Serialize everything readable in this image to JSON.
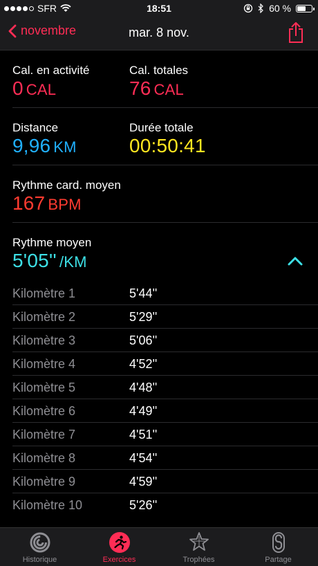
{
  "status_bar": {
    "carrier": "SFR",
    "time": "18:51",
    "battery": "60 %",
    "battery_level": 0.6
  },
  "nav": {
    "back_label": "novembre",
    "title": "mar. 8 nov."
  },
  "stats": {
    "active_cal": {
      "label": "Cal. en activité",
      "value": "0",
      "unit": "CAL",
      "color": "#ff2d55"
    },
    "total_cal": {
      "label": "Cal. totales",
      "value": "76",
      "unit": "CAL",
      "color": "#ff2d55"
    },
    "distance": {
      "label": "Distance",
      "value": "9,96",
      "unit": "KM",
      "color": "#20b0ff"
    },
    "duration": {
      "label": "Durée totale",
      "value": "00:50:41",
      "color": "#ffe620"
    },
    "heart_rate": {
      "label": "Rythme card. moyen",
      "value": "167",
      "unit": "BPM",
      "color": "#ff3b30"
    },
    "pace": {
      "label": "Rythme moyen",
      "value": "5'05''",
      "unit": "/KM",
      "color": "#3de0e6"
    }
  },
  "km_splits": [
    {
      "label": "Kilomètre 1",
      "pace": "5'44''"
    },
    {
      "label": "Kilomètre 2",
      "pace": "5'29''"
    },
    {
      "label": "Kilomètre 3",
      "pace": "5'06''"
    },
    {
      "label": "Kilomètre 4",
      "pace": "4'52''"
    },
    {
      "label": "Kilomètre 5",
      "pace": "4'48''"
    },
    {
      "label": "Kilomètre 6",
      "pace": "4'49''"
    },
    {
      "label": "Kilomètre 7",
      "pace": "4'51''"
    },
    {
      "label": "Kilomètre 8",
      "pace": "4'54''"
    },
    {
      "label": "Kilomètre 9",
      "pace": "4'59''"
    },
    {
      "label": "Kilomètre 10",
      "pace": "5'26''"
    }
  ],
  "tabs": [
    {
      "label": "Historique",
      "icon": "history-rings-icon",
      "active": false
    },
    {
      "label": "Exercices",
      "icon": "running-icon",
      "active": true
    },
    {
      "label": "Trophées",
      "icon": "trophy-star-icon",
      "active": false
    },
    {
      "label": "Partage",
      "icon": "share-s-icon",
      "active": false
    }
  ],
  "colors": {
    "accent": "#ff2d55",
    "background": "#000000",
    "bar": "#1c1c1e",
    "chevron": "#3de0e6"
  }
}
